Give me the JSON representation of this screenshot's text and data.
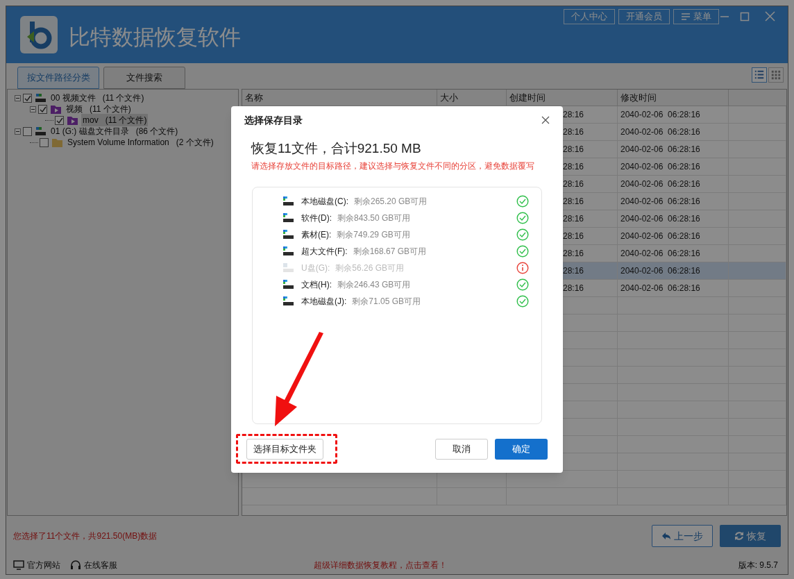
{
  "app": {
    "title": "比特数据恢复软件",
    "header_buttons": [
      "个人中心",
      "开通会员",
      "菜单"
    ]
  },
  "view_tabs": [
    {
      "label": "按文件路径分类",
      "selected": true
    },
    {
      "label": "文件搜索",
      "selected": false
    }
  ],
  "view_mode": [
    {
      "kind": "list",
      "selected": true
    },
    {
      "kind": "grid",
      "selected": false
    }
  ],
  "tree": [
    {
      "kind": "drive",
      "label": "00 视频文件",
      "count": "(11 个文件)",
      "checked": true,
      "expanded": true,
      "selected": false,
      "children": [
        {
          "kind": "video-folder",
          "label": "视频",
          "count": "(11 个文件)",
          "checked": true,
          "expanded": true,
          "selected": false,
          "children": [
            {
              "kind": "video-folder",
              "label": "mov",
              "count": "(11 个文件)",
              "checked": true,
              "selected": true
            }
          ]
        }
      ]
    },
    {
      "kind": "drive",
      "label": "01 (G:) 磁盘文件目录",
      "count": "(86 个文件)",
      "checked": false,
      "expanded": true,
      "selected": false,
      "children": [
        {
          "kind": "folder",
          "label": "System Volume Information",
          "count": "(2 个文件)",
          "checked": false,
          "selected": false
        }
      ]
    }
  ],
  "table": {
    "columns": [
      "名称",
      "大小",
      "创建时间",
      "修改时间"
    ],
    "rows": [
      {
        "created": "28:16",
        "modified": "2040-02-06  06:28:16",
        "selected": false
      },
      {
        "created": "28:16",
        "modified": "2040-02-06  06:28:16",
        "selected": false
      },
      {
        "created": "28:16",
        "modified": "2040-02-06  06:28:16",
        "selected": false
      },
      {
        "created": "28:16",
        "modified": "2040-02-06  06:28:16",
        "selected": false
      },
      {
        "created": "28:16",
        "modified": "2040-02-06  06:28:16",
        "selected": false
      },
      {
        "created": "28:16",
        "modified": "2040-02-06  06:28:16",
        "selected": false
      },
      {
        "created": "28:16",
        "modified": "2040-02-06  06:28:16",
        "selected": false
      },
      {
        "created": "28:16",
        "modified": "2040-02-06  06:28:16",
        "selected": false
      },
      {
        "created": "28:16",
        "modified": "2040-02-06  06:28:16",
        "selected": false
      },
      {
        "created": "28:16",
        "modified": "2040-02-06  06:28:16",
        "selected": true
      },
      {
        "created": "28:16",
        "modified": "2040-02-06  06:28:16",
        "selected": false
      }
    ]
  },
  "status": {
    "summary": "您选择了11个文件，共921.50(MB)数据",
    "back_button": "上一步",
    "recover_button": "恢复"
  },
  "footer": {
    "website": "官方网站",
    "support": "在线客服",
    "tutorial": "超级详细数据恢复教程，点击查看！",
    "version": "版本: 9.5.7"
  },
  "dialog": {
    "title": "选择保存目录",
    "heading": "恢复11文件，合计921.50 MB",
    "warning": "请选择存放文件的目标路径，建议选择与恢复文件不同的分区，避免数据覆写",
    "drives": [
      {
        "name": "本地磁盘(C):",
        "free": "剩余265.20 GB可用",
        "available": true
      },
      {
        "name": "软件(D):",
        "free": "剩余843.50 GB可用",
        "available": true
      },
      {
        "name": "素材(E):",
        "free": "剩余749.29 GB可用",
        "available": true
      },
      {
        "name": "超大文件(F):",
        "free": "剩余168.67 GB可用",
        "available": true
      },
      {
        "name": "U盘(G):",
        "free": "剩余56.26 GB可用",
        "available": false
      },
      {
        "name": "文档(H):",
        "free": "剩余246.43 GB可用",
        "available": true
      },
      {
        "name": "本地磁盘(J):",
        "free": "剩余71.05 GB可用",
        "available": true
      }
    ],
    "choose_button": "选择目标文件夹",
    "cancel_button": "取消",
    "ok_button": "确定"
  }
}
